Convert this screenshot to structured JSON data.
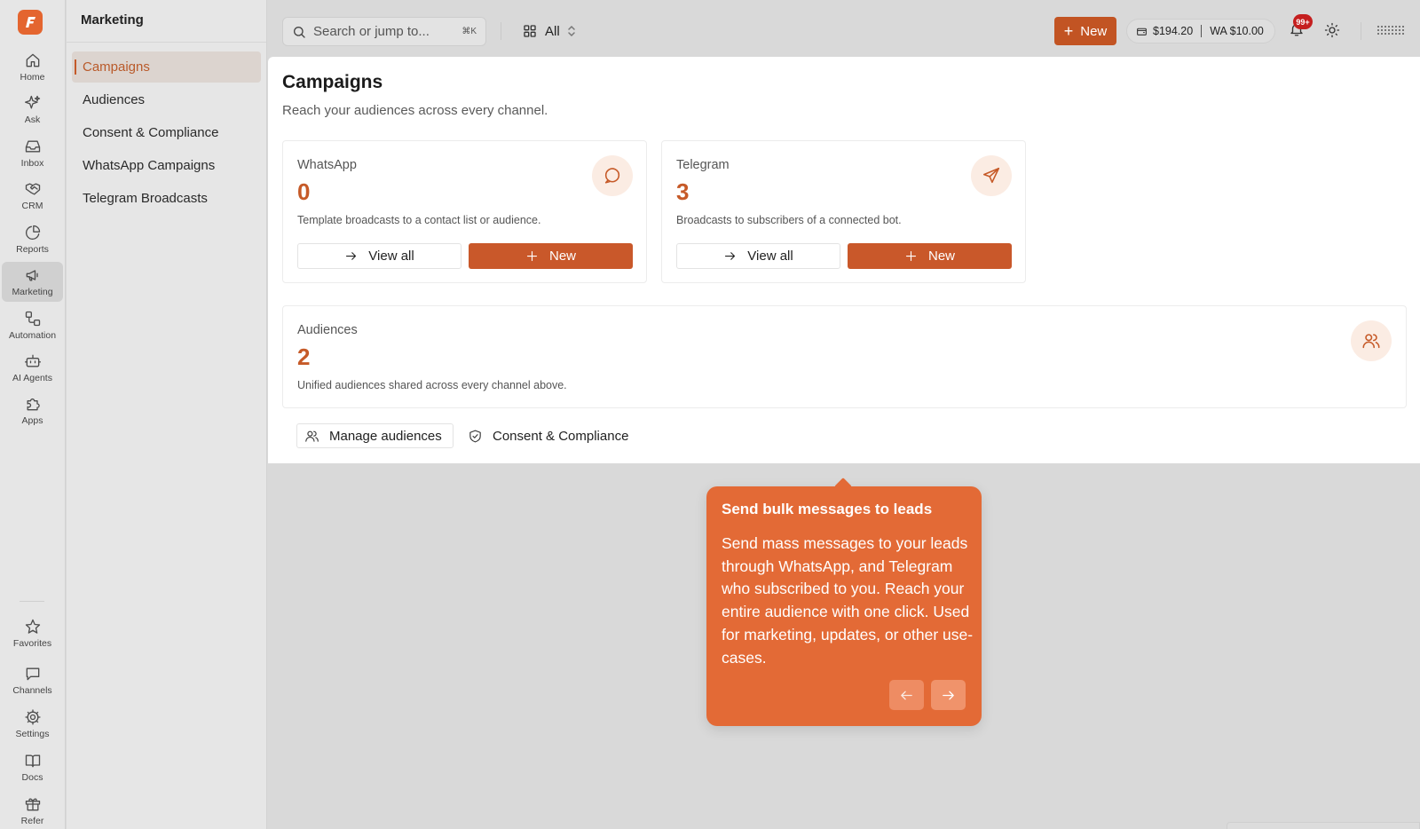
{
  "app": {
    "accent": "#e4652f",
    "primary_button": "#c9582a"
  },
  "rail": {
    "items": [
      {
        "label": "Home",
        "icon": "home-icon"
      },
      {
        "label": "Ask",
        "icon": "sparkles-icon"
      },
      {
        "label": "Inbox",
        "icon": "inbox-icon"
      },
      {
        "label": "CRM",
        "icon": "handshake-icon"
      },
      {
        "label": "Reports",
        "icon": "pie-chart-icon"
      },
      {
        "label": "Marketing",
        "icon": "megaphone-icon"
      },
      {
        "label": "Automation",
        "icon": "workflow-icon"
      },
      {
        "label": "AI Agents",
        "icon": "bot-icon"
      },
      {
        "label": "Apps",
        "icon": "puzzle-icon"
      }
    ],
    "bottom_items": [
      {
        "label": "Favorites",
        "icon": "star-icon"
      },
      {
        "label": "Channels",
        "icon": "chat-icon"
      },
      {
        "label": "Settings",
        "icon": "gear-icon"
      },
      {
        "label": "Docs",
        "icon": "book-icon"
      },
      {
        "label": "Refer",
        "icon": "gift-icon"
      }
    ]
  },
  "subnav": {
    "title": "Marketing",
    "items": [
      {
        "label": "Campaigns"
      },
      {
        "label": "Audiences"
      },
      {
        "label": "Consent & Compliance"
      },
      {
        "label": "WhatsApp Campaigns"
      },
      {
        "label": "Telegram Broadcasts"
      }
    ]
  },
  "topbar": {
    "search_placeholder": "Search or jump to...",
    "search_shortcut": "⌘K",
    "scope_label": "All",
    "new_label": "New",
    "balance_main": "$194.20",
    "balance_wa": "WA $10.00",
    "notifications_badge": "99+"
  },
  "page": {
    "title": "Campaigns",
    "subtitle": "Reach your audiences across every channel."
  },
  "cards": {
    "whatsapp": {
      "name": "WhatsApp",
      "count": "0",
      "description": "Template broadcasts to a contact list or audience.",
      "view_all_label": "View all",
      "new_label": "New"
    },
    "telegram": {
      "name": "Telegram",
      "count": "3",
      "description": "Broadcasts to subscribers of a connected bot.",
      "view_all_label": "View all",
      "new_label": "New"
    },
    "audiences": {
      "name": "Audiences",
      "count": "2",
      "description": "Unified audiences shared across every channel above."
    }
  },
  "actions": {
    "manage_audiences_label": "Manage audiences",
    "consent_label": "Consent & Compliance"
  },
  "tooltip": {
    "title": "Send bulk messages to leads",
    "body": "Send mass messages to your leads through WhatsApp, and Telegram who subscribed to you. Reach your entire audience with one click. Used for marketing, updates, or other use-cases."
  }
}
